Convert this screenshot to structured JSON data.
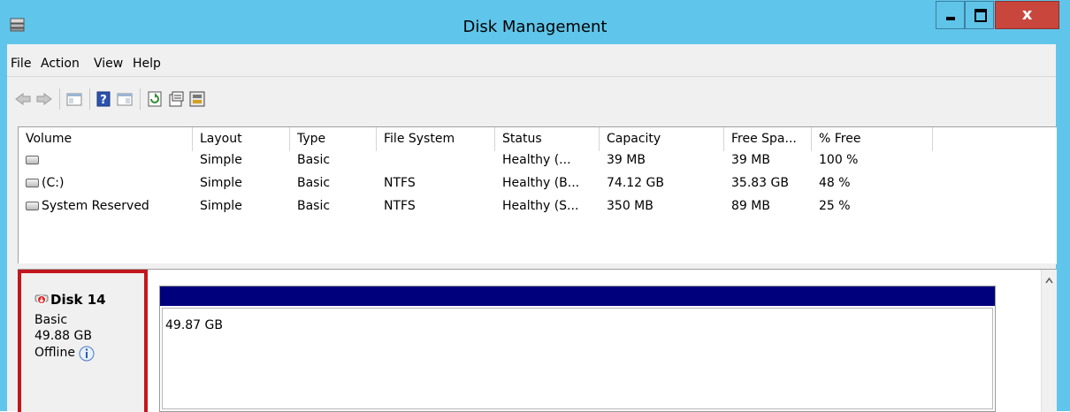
{
  "window": {
    "title": "Disk Management",
    "controls": {
      "minimize": "minimize",
      "maximize": "maximize",
      "close": "x"
    }
  },
  "menu": [
    "File",
    "Action",
    "View",
    "Help"
  ],
  "toolbar": [
    "back-arrow-icon",
    "forward-arrow-icon",
    "show-hide-console-tree-icon",
    "help-icon",
    "show-hide-action-pane-icon",
    "refresh-icon",
    "properties-icon",
    "rescan-disks-icon"
  ],
  "volume_list": {
    "columns": [
      "Volume",
      "Layout",
      "Type",
      "File System",
      "Status",
      "Capacity",
      "Free Spa...",
      "% Free"
    ],
    "rows": [
      {
        "volume": "",
        "layout": "Simple",
        "type": "Basic",
        "fs": "",
        "status": "Healthy (...",
        "capacity": "39 MB",
        "free": "39 MB",
        "pct": "100 %"
      },
      {
        "volume": "(C:)",
        "layout": "Simple",
        "type": "Basic",
        "fs": "NTFS",
        "status": "Healthy (B...",
        "capacity": "74.12 GB",
        "free": "35.83 GB",
        "pct": "48 %"
      },
      {
        "volume": "System Reserved",
        "layout": "Simple",
        "type": "Basic",
        "fs": "NTFS",
        "status": "Healthy (S...",
        "capacity": "350 MB",
        "free": "89 MB",
        "pct": "25 %"
      }
    ]
  },
  "disk": {
    "name": "Disk 14",
    "type": "Basic",
    "size": "49.88 GB",
    "status": "Offline",
    "partition_size": "49.87 GB"
  },
  "colors": {
    "titlebar": "#5fc5ea",
    "partition_bar": "#00007d",
    "highlight": "#c3161c",
    "close_button": "#c9463d"
  }
}
